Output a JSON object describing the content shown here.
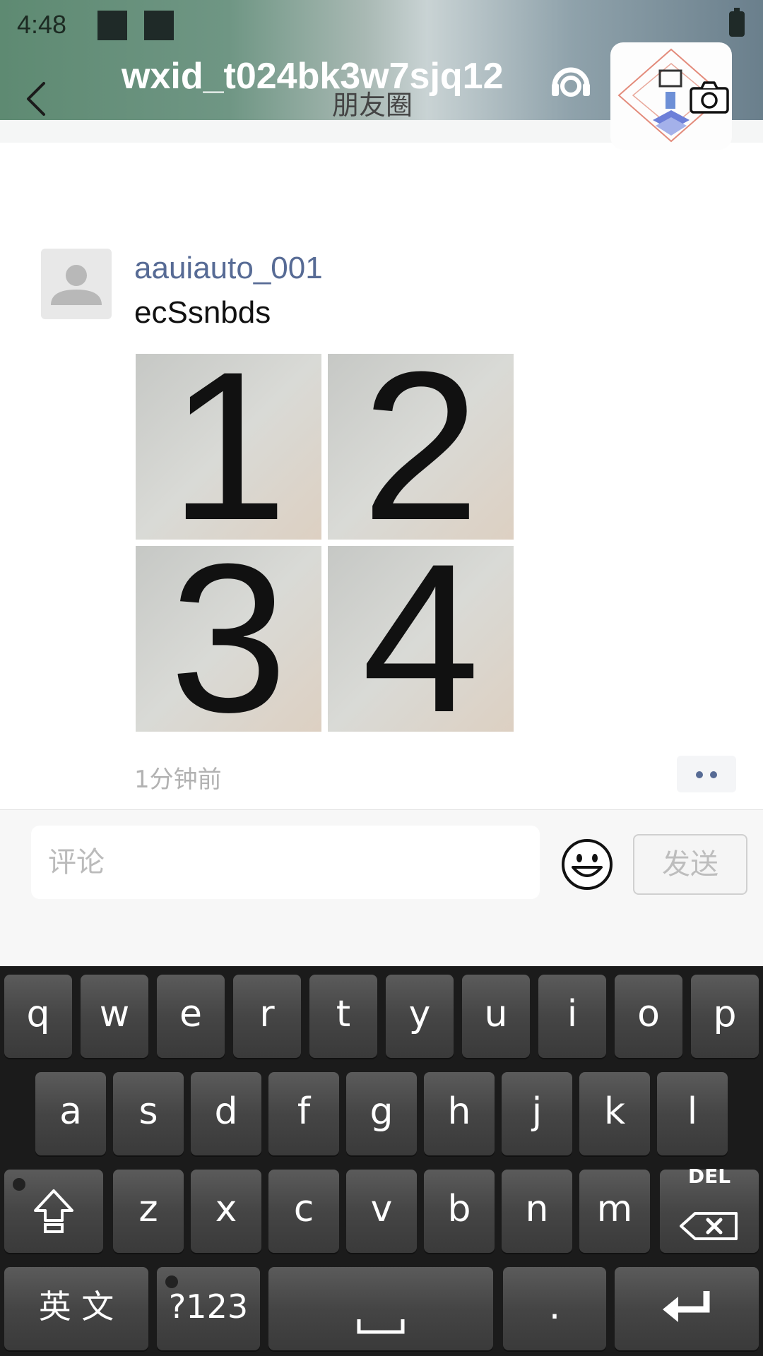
{
  "status_bar": {
    "time": "4:48"
  },
  "header": {
    "profile_name": "wxid_t024bk3w7sjq12",
    "page_title": "朋友圈"
  },
  "post": {
    "username": "aauiauto_001",
    "text": "ecSsnbds",
    "photos": [
      "1",
      "2",
      "3",
      "4"
    ],
    "time_ago": "1分钟前"
  },
  "comment": {
    "placeholder": "评论",
    "value": "",
    "send_label": "发送"
  },
  "keyboard": {
    "row1": [
      "q",
      "w",
      "e",
      "r",
      "t",
      "y",
      "u",
      "i",
      "o",
      "p"
    ],
    "row2": [
      "a",
      "s",
      "d",
      "f",
      "g",
      "h",
      "j",
      "k",
      "l"
    ],
    "row3": [
      "z",
      "x",
      "c",
      "v",
      "b",
      "n",
      "m"
    ],
    "delete_label": "DEL",
    "lang_label": "英 文",
    "symbols_label": "?123",
    "period_label": "."
  },
  "colors": {
    "link_blue": "#576b95",
    "time_gray": "#b2b2b2"
  }
}
